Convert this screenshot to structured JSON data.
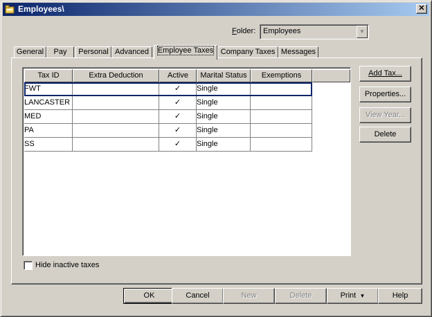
{
  "window": {
    "title": "Employees\\",
    "close_glyph": "✕",
    "app_icon": "folder-icon"
  },
  "folder": {
    "label": "Folder:",
    "value": "Employees"
  },
  "tabs": [
    {
      "label": "General"
    },
    {
      "label": "Pay"
    },
    {
      "label": "Personal"
    },
    {
      "label": "Advanced"
    },
    {
      "label": "Employee Taxes",
      "active": true
    },
    {
      "label": "Company Taxes"
    },
    {
      "label": "Messages"
    }
  ],
  "grid": {
    "columns": [
      "Tax ID",
      "Extra Deduction",
      "Active",
      "Marital Status",
      "Exemptions"
    ],
    "rows": [
      {
        "tax_id": "FWT",
        "extra_deduction": "",
        "active": "✓",
        "marital_status": "Single",
        "exemptions": ""
      },
      {
        "tax_id": "LANCASTER",
        "extra_deduction": "",
        "active": "✓",
        "marital_status": "Single",
        "exemptions": ""
      },
      {
        "tax_id": "MED",
        "extra_deduction": "",
        "active": "✓",
        "marital_status": "Single",
        "exemptions": ""
      },
      {
        "tax_id": "PA",
        "extra_deduction": "",
        "active": "✓",
        "marital_status": "Single",
        "exemptions": ""
      },
      {
        "tax_id": "SS",
        "extra_deduction": "",
        "active": "✓",
        "marital_status": "Single",
        "exemptions": ""
      }
    ]
  },
  "side_buttons": {
    "add_tax": "Add Tax...",
    "properties": "Properties...",
    "view_year": "View Year...",
    "delete": "Delete"
  },
  "hide_inactive": {
    "label": "Hide inactive taxes",
    "checked": false
  },
  "bottom_buttons": {
    "ok": "OK",
    "cancel": "Cancel",
    "new": "New",
    "delete": "Delete",
    "print": "Print",
    "help": "Help"
  },
  "colors": {
    "titlebar_start": "#0a246a",
    "titlebar_end": "#a6caf0",
    "face": "#d4d0c8",
    "selection_border": "#0a246a"
  }
}
